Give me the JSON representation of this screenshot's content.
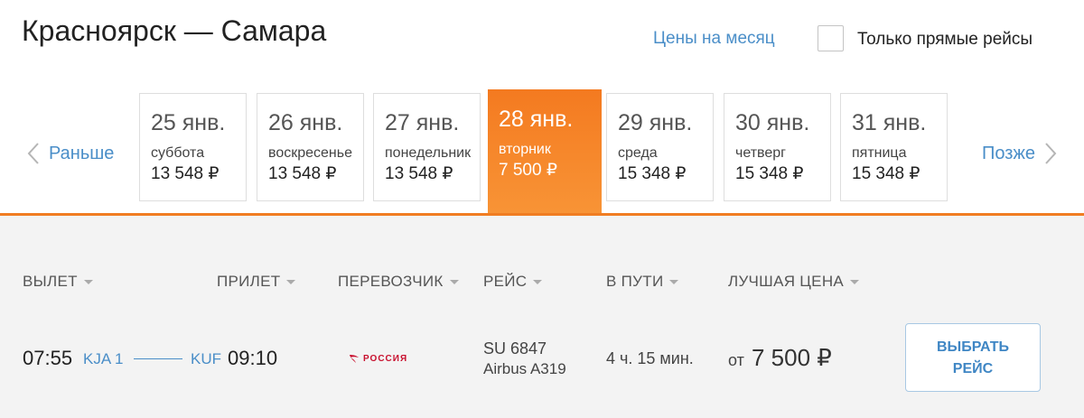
{
  "header": {
    "route": "Красноярск — Самара",
    "month_prices_link": "Цены на месяц",
    "direct_only_label": "Только прямые рейсы",
    "direct_only_checked": false
  },
  "date_nav": {
    "prev_label": "Раньше",
    "next_label": "Позже",
    "days": [
      {
        "date": "25 янв.",
        "weekday": "суббота",
        "price": "13 548 ₽",
        "active": false
      },
      {
        "date": "26 янв.",
        "weekday": "воскресенье",
        "price": "13 548 ₽",
        "active": false
      },
      {
        "date": "27 янв.",
        "weekday": "понедельник",
        "price": "13 548 ₽",
        "active": false
      },
      {
        "date": "28 янв.",
        "weekday": "вторник",
        "price": "7 500 ₽",
        "active": true
      },
      {
        "date": "29 янв.",
        "weekday": "среда",
        "price": "15 348 ₽",
        "active": false
      },
      {
        "date": "30 янв.",
        "weekday": "четверг",
        "price": "15 348 ₽",
        "active": false
      },
      {
        "date": "31 янв.",
        "weekday": "пятница",
        "price": "15 348 ₽",
        "active": false
      }
    ]
  },
  "columns": {
    "departure": "ВЫЛЕТ",
    "arrival": "ПРИЛЕТ",
    "carrier": "ПЕРЕВОЗЧИК",
    "flight": "РЕЙС",
    "duration": "В ПУТИ",
    "best_price": "ЛУЧШАЯ ЦЕНА"
  },
  "flight": {
    "dep_time": "07:55",
    "dep_airport": "KJA 1",
    "arr_airport": "KUF",
    "arr_time": "09:10",
    "carrier_logo_text": "РОССИЯ",
    "flight_number": "SU 6847",
    "aircraft": "Airbus A319",
    "duration": "4 ч. 15 мин.",
    "price_prefix": "от",
    "price": "7 500 ₽",
    "select_label_line1": "ВЫБРАТЬ",
    "select_label_line2": "РЕЙС"
  },
  "colors": {
    "accent_orange": "#f47a20",
    "link_blue": "#4a8ec8",
    "brand_red": "#c8102e"
  }
}
